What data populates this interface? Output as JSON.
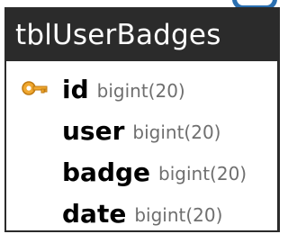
{
  "table": {
    "name": "tblUserBadges",
    "fields": [
      {
        "name": "id",
        "type": "bigint(20)",
        "primary_key": true,
        "icon": "key-icon"
      },
      {
        "name": "user",
        "type": "bigint(20)",
        "primary_key": false
      },
      {
        "name": "badge",
        "type": "bigint(20)",
        "primary_key": false
      },
      {
        "name": "date",
        "type": "bigint(20)",
        "primary_key": false
      }
    ]
  },
  "colors": {
    "header_background": "#2b2b2b",
    "header_text": "#ffffff",
    "key_icon": "#f0a830",
    "type_text": "#6f6f6f"
  }
}
